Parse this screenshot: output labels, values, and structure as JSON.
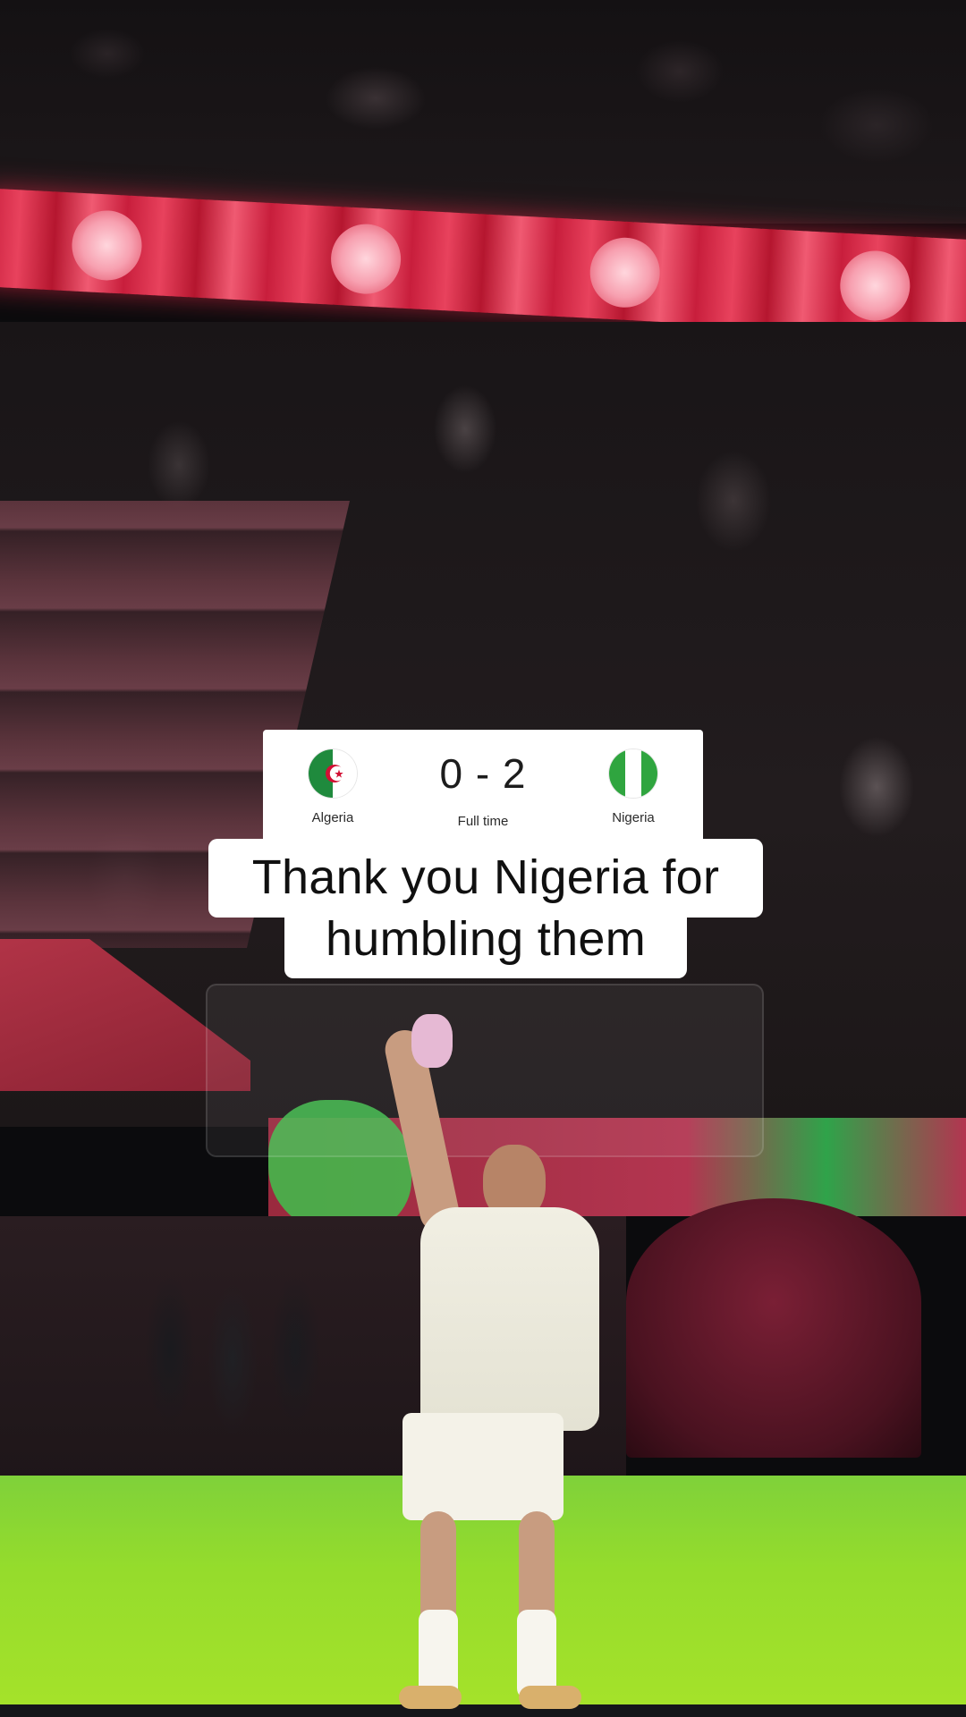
{
  "match": {
    "home_team": "Algeria",
    "away_team": "Nigeria",
    "score": "0 - 2",
    "status": "Full time",
    "home_flag_icon": "algeria-flag-icon",
    "away_flag_icon": "nigeria-flag-icon"
  },
  "caption": {
    "line1": "Thank you Nigeria for",
    "line2": "humbling them"
  },
  "colors": {
    "algeria_green": "#1f8a3d",
    "algeria_red": "#d21034",
    "nigeria_green": "#2fa53f",
    "led_red": "#c81e3c",
    "pitch_green": "#95dc2c"
  }
}
